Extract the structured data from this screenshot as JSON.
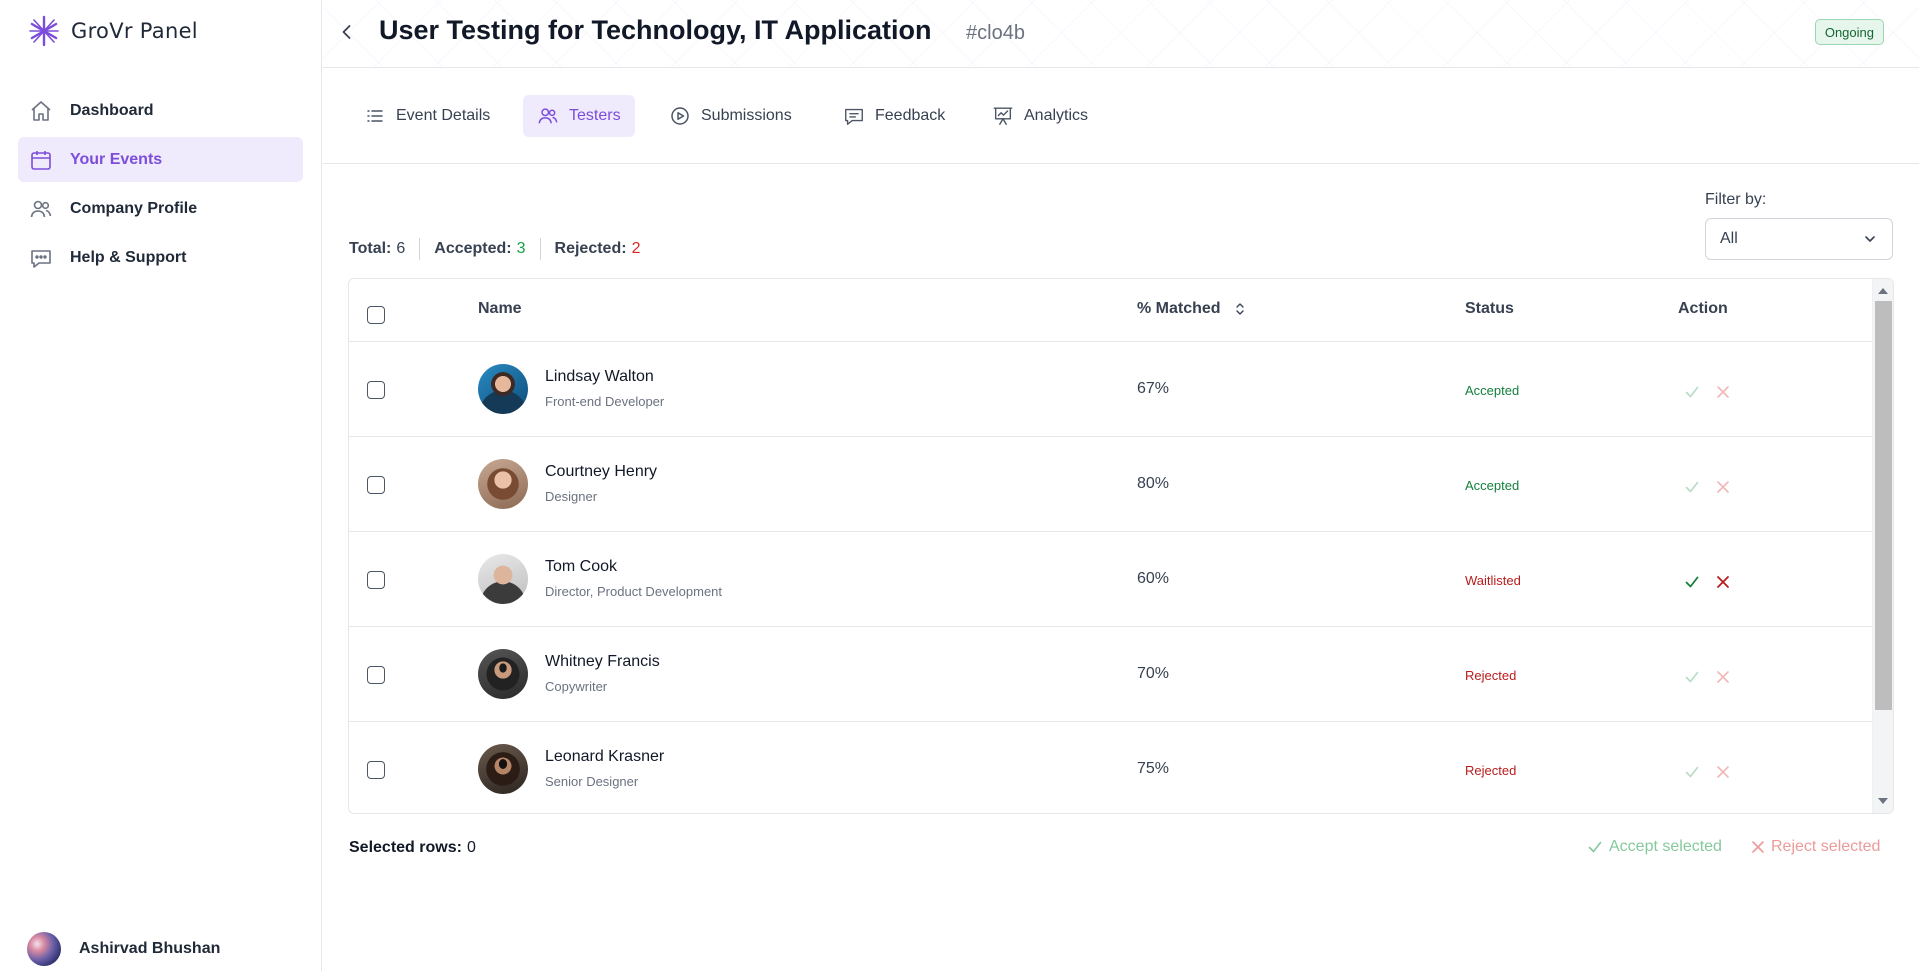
{
  "brand": {
    "name": "GroVr Panel",
    "icon": "snowflake-logo",
    "accent": "#7c4ddb"
  },
  "sidebar": {
    "items": [
      {
        "label": "Dashboard",
        "icon": "home-icon",
        "active": false
      },
      {
        "label": "Your Events",
        "icon": "calendar-icon",
        "active": true
      },
      {
        "label": "Company Profile",
        "icon": "users-icon",
        "active": false
      },
      {
        "label": "Help & Support",
        "icon": "chat-bubble-icon",
        "active": false
      }
    ],
    "user": {
      "name": "Ashirvad Bhushan"
    }
  },
  "header": {
    "title": "User Testing for Technology, IT Application",
    "event_id": "#clo4b",
    "status": "Ongoing"
  },
  "tabs": [
    {
      "label": "Event Details",
      "icon": "list-icon",
      "active": false
    },
    {
      "label": "Testers",
      "icon": "users-icon",
      "active": true
    },
    {
      "label": "Submissions",
      "icon": "play-circle-icon",
      "active": false
    },
    {
      "label": "Feedback",
      "icon": "message-icon",
      "active": false
    },
    {
      "label": "Analytics",
      "icon": "presentation-chart-icon",
      "active": false
    }
  ],
  "summary": {
    "total_label": "Total:",
    "total": "6",
    "accepted_label": "Accepted:",
    "accepted": "3",
    "rejected_label": "Rejected:",
    "rejected": "2"
  },
  "filter": {
    "label": "Filter by:",
    "value": "All"
  },
  "table": {
    "columns": {
      "name": "Name",
      "matched": "% Matched",
      "status": "Status",
      "action": "Action"
    },
    "rows": [
      {
        "name": "Lindsay Walton",
        "role": "Front-end Developer",
        "matched": "67%",
        "status": "Accepted",
        "actions_enabled": false
      },
      {
        "name": "Courtney Henry",
        "role": "Designer",
        "matched": "80%",
        "status": "Accepted",
        "actions_enabled": false
      },
      {
        "name": "Tom Cook",
        "role": "Director, Product Development",
        "matched": "60%",
        "status": "Waitlisted",
        "actions_enabled": true
      },
      {
        "name": "Whitney Francis",
        "role": "Copywriter",
        "matched": "70%",
        "status": "Rejected",
        "actions_enabled": false
      },
      {
        "name": "Leonard Krasner",
        "role": "Senior Designer",
        "matched": "75%",
        "status": "Rejected",
        "actions_enabled": false
      }
    ]
  },
  "footer": {
    "selected_label": "Selected rows:",
    "selected_count": "0",
    "accept_label": "Accept selected",
    "reject_label": "Reject selected"
  },
  "colors": {
    "accepted": "#15803d",
    "rejected": "#b91c1c",
    "waitlisted": "#b91c1c",
    "count_green": "#16a34a",
    "count_red": "#dc2626"
  }
}
